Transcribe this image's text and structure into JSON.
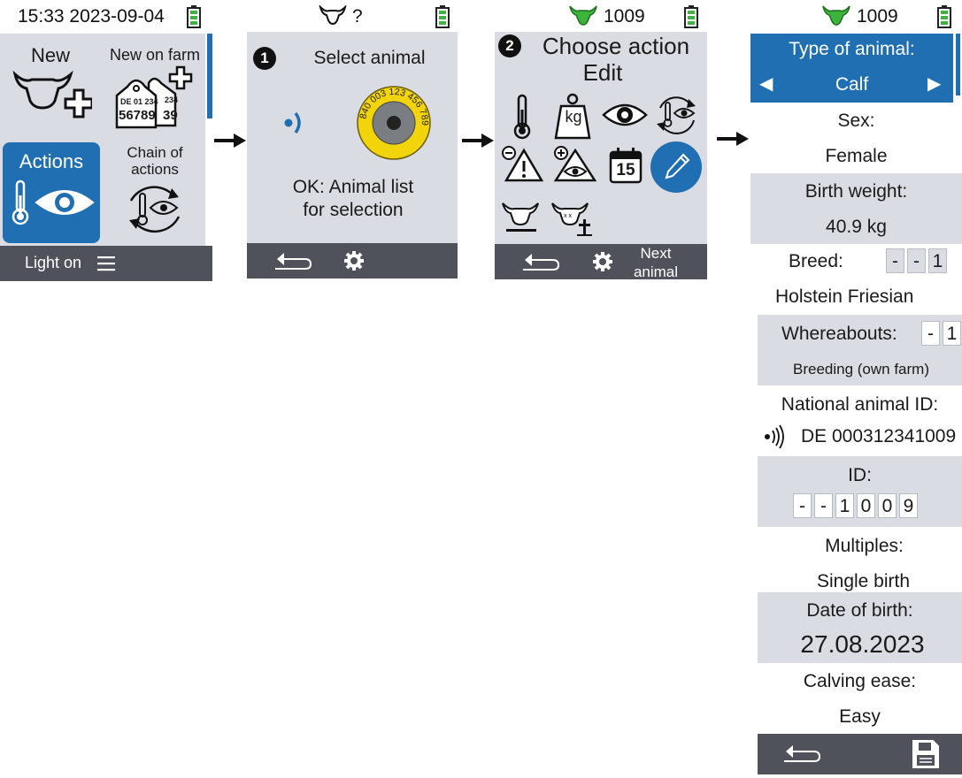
{
  "screen1": {
    "status_time": "15:33 2023-09-04",
    "tiles": {
      "new_label": "New",
      "new_on_farm_label": "New on farm",
      "tag_text_top": "DE 01 234",
      "tag_text_big": "56789",
      "tag_text_back": "234",
      "tag_text_back_big": "39",
      "actions_label": "Actions",
      "chain_label_1": "Chain of",
      "chain_label_2": "actions"
    },
    "bottom": {
      "light": "Light on"
    }
  },
  "screen2": {
    "status_label": "?",
    "step_number": "1",
    "title": "Select animal",
    "tag_ring_text": "840 003 123 456 789",
    "hint_line1": "OK: Animal list",
    "hint_line2": "for selection"
  },
  "screen3": {
    "status_id": "1009",
    "step_number": "2",
    "title_line1": "Choose action",
    "title_line2": "Edit",
    "weight_unit": "kg",
    "calendar_day": "15",
    "next_line1": "Next",
    "next_line2": "animal"
  },
  "screen4": {
    "status_id": "1009",
    "type_label": "Type of animal:",
    "type_value": "Calf",
    "sex_label": "Sex:",
    "sex_value": "Female",
    "birth_weight_label": "Birth weight:",
    "birth_weight_value": "40.9 kg",
    "breed_label": "Breed:",
    "breed_digits": [
      "-",
      "-",
      "1"
    ],
    "breed_value": "Holstein Friesian",
    "whereabouts_label": "Whereabouts:",
    "whereabouts_digits": [
      "-",
      "1"
    ],
    "whereabouts_value": "Breeding (own farm)",
    "national_id_label": "National animal ID:",
    "national_id_value": "DE 000312341009",
    "id_label": "ID:",
    "id_digits": [
      "-",
      "-",
      "1",
      "0",
      "0",
      "9"
    ],
    "multiples_label": "Multiples:",
    "multiples_value": "Single birth",
    "dob_label": "Date of birth:",
    "dob_value": "27.08.2023",
    "calving_label": "Calving ease:",
    "calving_value": "Easy"
  },
  "colors": {
    "accent_blue": "#1f6fb2",
    "screen_grey": "#d9dde3",
    "bar_dark": "#4f525a",
    "battery_green": "#3db53d",
    "tag_yellow": "#f2d40c"
  }
}
